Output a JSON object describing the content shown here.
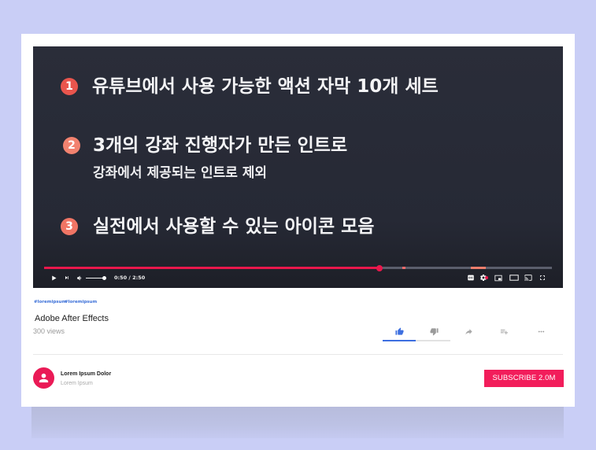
{
  "colors": {
    "page_background": "#c9cef6",
    "accent": "#e8184c",
    "like_blue": "#3d6fe0",
    "subscribe": "#f21d5b",
    "avatar": "#ea1a56"
  },
  "video": {
    "features": [
      {
        "number": "1",
        "text": "유튜브에서 사용 가능한 액션 자막 10개 세트",
        "color": "#e9554d"
      },
      {
        "number": "2",
        "text": "3개의 강좌 진행자가 만든 인트로",
        "subtext": "강좌에서 제공되는 인트로 제외",
        "color": "#f2826f"
      },
      {
        "number": "3",
        "text": "실전에서 사용할 수 있는 아이콘 모음",
        "color": "#f07565"
      }
    ]
  },
  "player": {
    "time": "0:50 / 2:50",
    "progress": 0.66,
    "volume": 0.92,
    "left_icons": [
      "play-icon",
      "next-icon",
      "volume-icon"
    ],
    "right_icons": [
      "captions-icon",
      "settings-icon",
      "miniplayer-icon",
      "theater-mode-icon",
      "cast-icon",
      "fullscreen-icon"
    ]
  },
  "hashtags": [
    "#loremipsum",
    "#loremipsum"
  ],
  "title": "Adobe After Effects",
  "views": "300 views",
  "actions": {
    "icons": [
      "thumbs-up-icon",
      "thumbs-down-icon",
      "share-icon",
      "playlist-add-icon",
      "more-icon"
    ],
    "like_ratio": 0.49
  },
  "channel": {
    "name": "Lorem Ipsum Dolor",
    "subtitle": "Lorem Ipsum",
    "avatar_icon": "person-icon"
  },
  "subscribe": {
    "label": "SUBSCRIBE 2.0M"
  }
}
